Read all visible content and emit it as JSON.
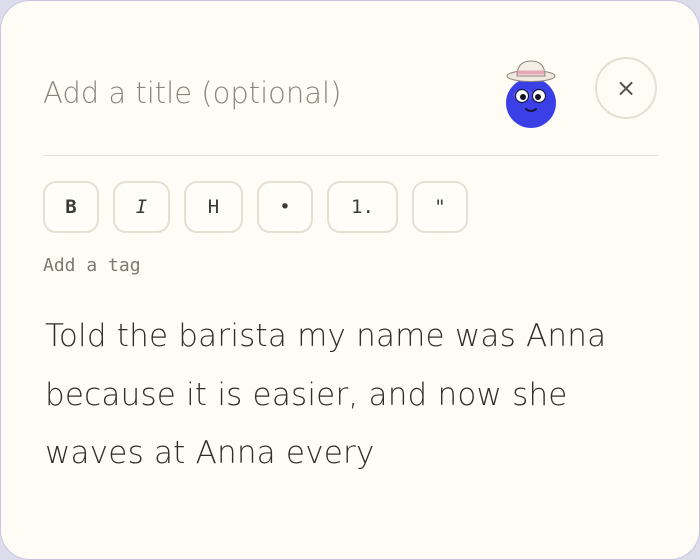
{
  "editor": {
    "title_placeholder": "Add a title (optional)",
    "title_value": "",
    "close_label": "×",
    "tag_placeholder": "Add a tag",
    "tag_value": "",
    "body_lines": [
      "Told the barista my name was Anna",
      "because it is easier, and now she",
      "waves at Anna every"
    ]
  },
  "toolbar": {
    "bold_label": "B",
    "italic_label": "I",
    "heading_label": "H",
    "bullet_label": "•",
    "numbered_label": "1.",
    "quote_label": "\""
  },
  "mascot": {
    "icon": "blue-blob-mascot-with-hat",
    "body_color": "#3b3fe6",
    "hat_color": "#efe9e0",
    "hat_band_color": "#e7a6b5"
  },
  "colors": {
    "background": "#fffcf5",
    "border": "#e4e0d2",
    "text": "#2f2e2b",
    "placeholder": "#8a867c"
  }
}
